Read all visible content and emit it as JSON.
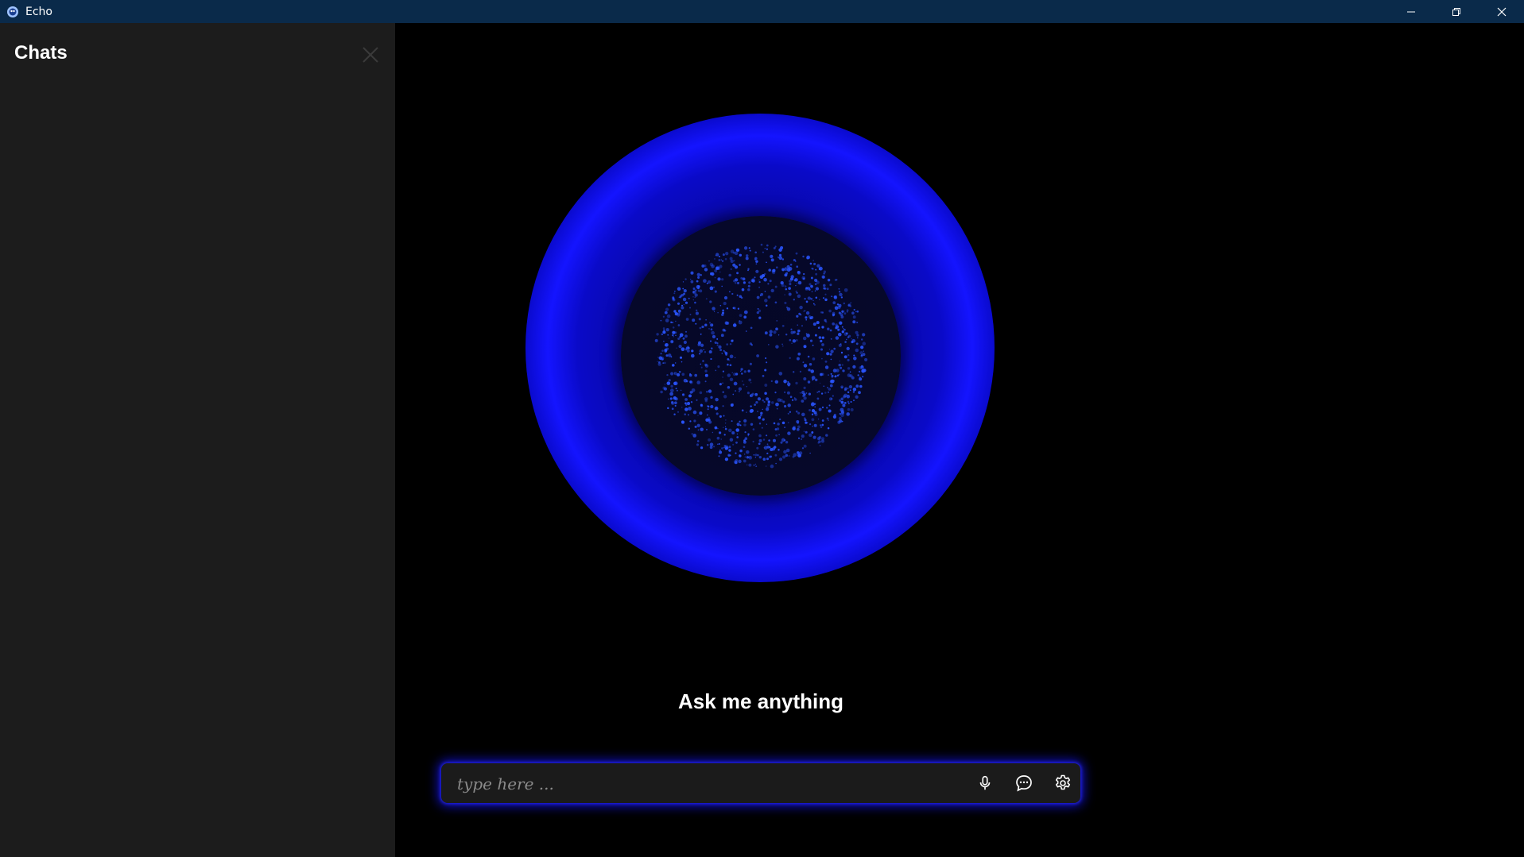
{
  "window": {
    "title": "Echo",
    "icons": {
      "app": "echo-app-icon",
      "minimize": "minimize-icon",
      "restore": "restore-icon",
      "close": "close-icon"
    }
  },
  "sidebar": {
    "title": "Chats",
    "close_icon": "close-icon",
    "items": []
  },
  "main": {
    "orb": {
      "glow_color": "#1414ff",
      "particle_color": "#2a55ff"
    },
    "prompt": "Ask me anything",
    "input": {
      "value": "",
      "placeholder": "type here ...",
      "icons": [
        "microphone-icon",
        "chat-bubble-icon",
        "settings-gear-icon"
      ]
    }
  },
  "colors": {
    "titlebar": "#0a2a4a",
    "sidebar": "#1c1c1c",
    "main_bg": "#000000",
    "accent": "#1414ff"
  }
}
